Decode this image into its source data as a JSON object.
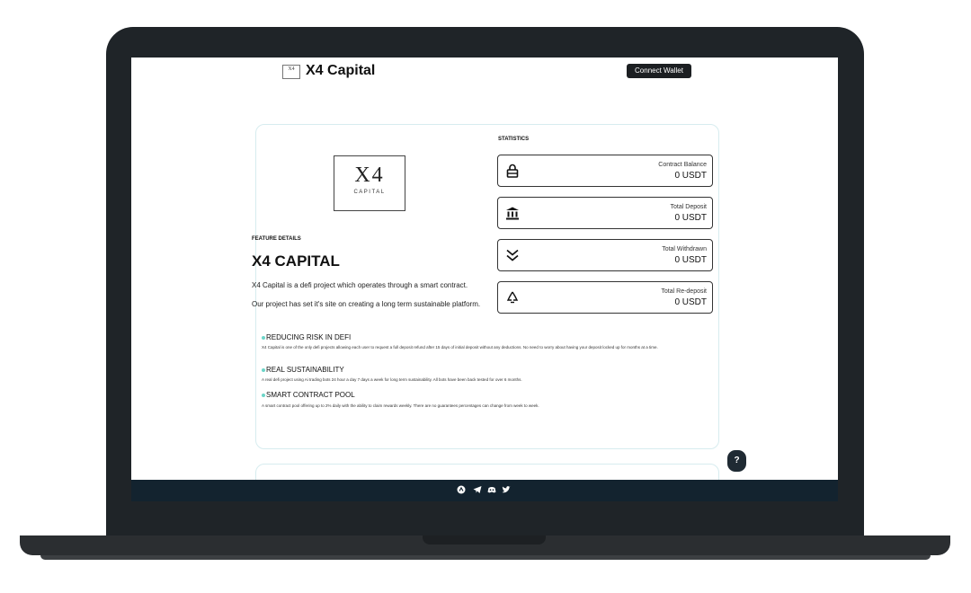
{
  "header": {
    "logo_mini_text": "X4",
    "brand": "X4 Capital",
    "connect_label": "Connect Wallet"
  },
  "logo": {
    "mark": "X4",
    "subtitle": "CAPITAL"
  },
  "feature": {
    "label": "FEATURE DETAILS",
    "title": "X4 CAPITAL",
    "desc1": "X4 Capital is a defi project which operates through a smart contract.",
    "desc2": "Our project has set it's site on creating a long term sustainable platform."
  },
  "statistics": {
    "label": "STATISTICS",
    "items": [
      {
        "label": "Contract Balance",
        "value": "0 USDT",
        "icon": "lock-icon"
      },
      {
        "label": "Total Deposit",
        "value": "0 USDT",
        "icon": "bank-icon"
      },
      {
        "label": "Total Withdrawn",
        "value": "0 USDT",
        "icon": "double-chevron-down-icon"
      },
      {
        "label": "Total Re-deposit",
        "value": "0 USDT",
        "icon": "recycle-icon"
      }
    ]
  },
  "sections": [
    {
      "title": "REDUCING RISK IN DEFI",
      "desc": "X4 Capital is one of the only defi projects allowing each user to request a full deposit refund after 15 days of initial deposit without any deductions. No need to worry about having your deposit locked up for months at a time."
    },
    {
      "title": "REAL SUSTAINABILITY",
      "desc": "A real defi project using Ai trading bots 24 hour a day 7 days a week for long term sustainability. All bots have been back tested for over 6 months."
    },
    {
      "title": "SMART CONTRACT POOL",
      "desc": "A smart contract pool offering up to 2% daily with the ability to claim rewards weekly. There are no guarantees percentages can change from week to week."
    }
  ],
  "help_label": "?",
  "footer_icons": [
    "coin-icon",
    "telegram-icon",
    "discord-icon",
    "twitter-icon"
  ],
  "colors": {
    "accent": "#6dd5c8",
    "footer": "#13232f",
    "button": "#1c1f22"
  }
}
